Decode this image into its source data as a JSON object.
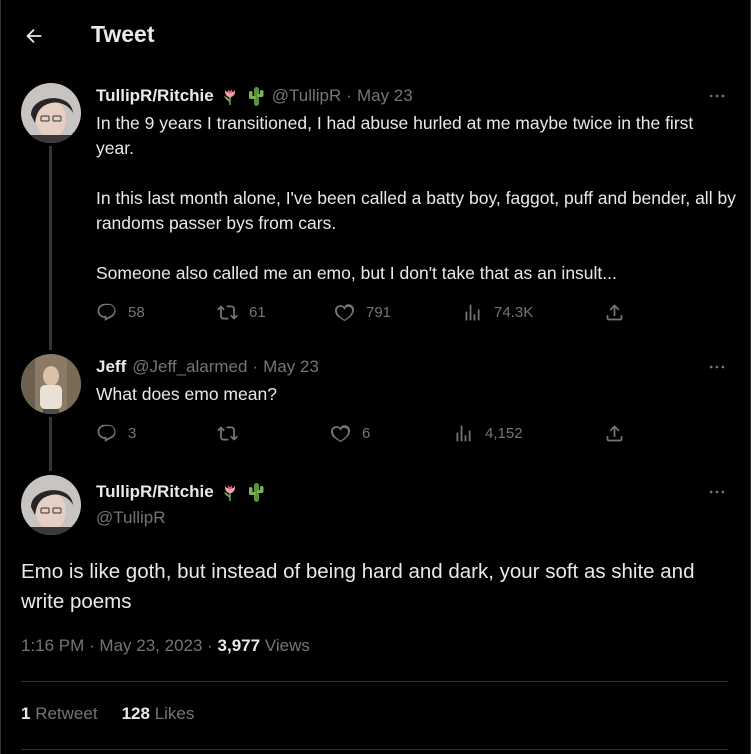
{
  "header": {
    "title": "Tweet",
    "back_icon": "arrow-left-icon"
  },
  "tweet1": {
    "display_name": "TullipR/Ritchie",
    "badges": [
      "tulip-emoji",
      "cactus-emoji"
    ],
    "handle": "@TullipR",
    "date": "May 23",
    "text": "In the 9 years I transitioned, I had abuse hurled at me maybe twice in the first year.\n\nIn this last month alone, I've been called a batty boy, faggot, puff and bender, all by randoms passer bys from cars.\n\nSomeone also called me an emo, but I don't take that as an insult...",
    "replies": "58",
    "retweets": "61",
    "likes": "791",
    "views": "74.3K"
  },
  "tweet2": {
    "display_name": "Jeff",
    "handle": "@Jeff_alarmed",
    "date": "May 23",
    "text": "What does emo  mean?",
    "replies": "3",
    "retweets": "",
    "likes": "6",
    "views": "4,152"
  },
  "focus": {
    "display_name": "TullipR/Ritchie",
    "badges": [
      "tulip-emoji",
      "cactus-emoji"
    ],
    "handle": "@TullipR",
    "text": "Emo is like goth, but instead of being hard and dark, your soft as shite and write poems",
    "time": "1:16 PM",
    "date": "May 23, 2023",
    "views_count": "3,977",
    "views_label": "Views",
    "retweet_count": "1",
    "retweet_label": "Retweet",
    "likes_count": "128",
    "likes_label": "Likes"
  },
  "colors": {
    "background": "#000000",
    "text": "#e7e9ea",
    "muted": "#71767b",
    "border": "#2f3336"
  }
}
